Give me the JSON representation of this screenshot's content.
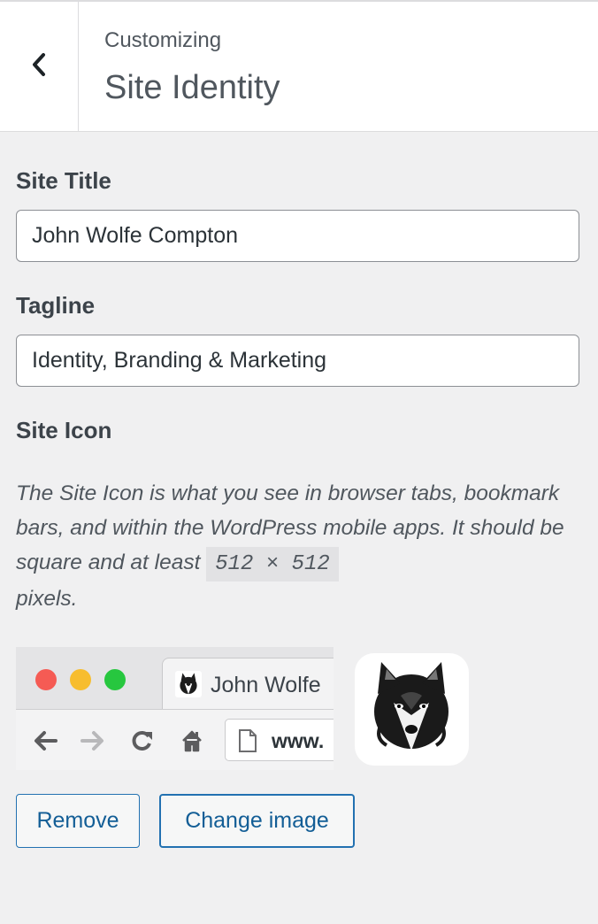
{
  "header": {
    "subtitle": "Customizing",
    "title": "Site Identity"
  },
  "site_title": {
    "label": "Site Title",
    "value": "John Wolfe Compton"
  },
  "tagline": {
    "label": "Tagline",
    "value": "Identity, Branding & Marketing"
  },
  "site_icon": {
    "label": "Site Icon",
    "description_before": "The Site Icon is what you see in browser tabs, bookmark bars, and within the WordPress mobile apps. It should be square and at least ",
    "size_code": "512 × 512",
    "description_after": " pixels.",
    "preview_tab_title": "John Wolfe",
    "preview_url": "www.",
    "remove_label": "Remove",
    "change_label": "Change image"
  },
  "colors": {
    "accent": "#2271b1",
    "dot_red": "#f55b54",
    "dot_yellow": "#f7bd2e",
    "dot_green": "#27c73f"
  }
}
